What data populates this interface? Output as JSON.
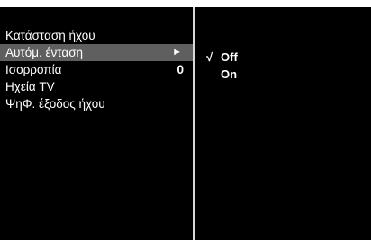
{
  "left_menu": {
    "items": [
      {
        "label": "Κατάσταση ήχου",
        "value": "",
        "selected": false
      },
      {
        "label": "Αυτόμ. ένταση",
        "value": "",
        "selected": true
      },
      {
        "label": "Ισορροπία",
        "value": "0",
        "selected": false
      },
      {
        "label": "Ηχεία TV",
        "value": "",
        "selected": false
      },
      {
        "label": "ΨηΦ. έξοδος ήχου",
        "value": "",
        "selected": false
      }
    ],
    "selected_arrow": "►"
  },
  "submenu": {
    "check_mark": "√",
    "options": [
      {
        "label": "Off",
        "checked": true
      },
      {
        "label": "On",
        "checked": false
      }
    ]
  },
  "colors": {
    "background": "#000000",
    "highlight": "#5f5f5f",
    "text": "#ffffff",
    "divider": "#d9d9d9"
  }
}
